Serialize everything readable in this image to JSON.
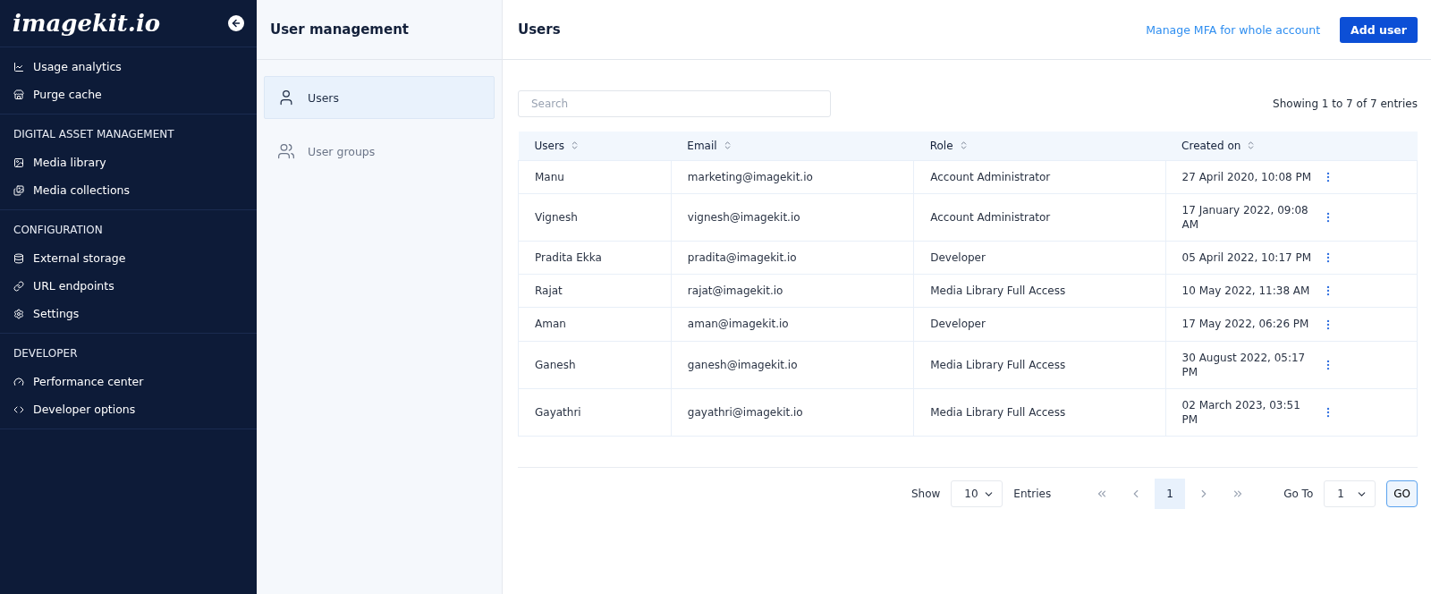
{
  "sidebar": {
    "logo": "imagekit.io",
    "sections": [
      {
        "items": [
          {
            "label": "Usage analytics"
          },
          {
            "label": "Purge cache"
          }
        ]
      },
      {
        "heading": "DIGITAL ASSET MANAGEMENT",
        "items": [
          {
            "label": "Media library"
          },
          {
            "label": "Media collections"
          }
        ]
      },
      {
        "heading": "CONFIGURATION",
        "items": [
          {
            "label": "External storage"
          },
          {
            "label": "URL endpoints"
          },
          {
            "label": "Settings"
          }
        ]
      },
      {
        "heading": "DEVELOPER",
        "items": [
          {
            "label": "Performance center"
          },
          {
            "label": "Developer options"
          }
        ]
      }
    ]
  },
  "subnav": {
    "title": "User management",
    "items": [
      {
        "label": "Users",
        "selected": true
      },
      {
        "label": "User groups",
        "selected": false
      }
    ]
  },
  "header": {
    "title": "Users",
    "link": "Manage MFA for whole account",
    "button": "Add user"
  },
  "search": {
    "placeholder": "Search"
  },
  "summary": "Showing 1 to 7 of 7 entries",
  "table": {
    "columns": [
      "Users",
      "Email",
      "Role",
      "Created on"
    ],
    "rows": [
      [
        "Manu",
        "marketing@imagekit.io",
        "Account Administrator",
        "27 April 2020, 10:08 PM"
      ],
      [
        "Vignesh",
        "vignesh@imagekit.io",
        "Account Administrator",
        "17 January 2022, 09:08 AM"
      ],
      [
        "Pradita Ekka",
        "pradita@imagekit.io",
        "Developer",
        "05 April 2022, 10:17 PM"
      ],
      [
        "Rajat",
        "rajat@imagekit.io",
        "Media Library Full Access",
        "10 May 2022, 11:38 AM"
      ],
      [
        "Aman",
        "aman@imagekit.io",
        "Developer",
        "17 May 2022, 06:26 PM"
      ],
      [
        "Ganesh",
        "ganesh@imagekit.io",
        "Media Library Full Access",
        "30 August 2022, 05:17 PM"
      ],
      [
        "Gayathri",
        "gayathri@imagekit.io",
        "Media Library Full Access",
        "02 March 2023, 03:51 PM"
      ]
    ]
  },
  "pagination": {
    "show_label": "Show",
    "page_size": "10",
    "entries_label": "Entries",
    "pages": [
      {
        "label": "1",
        "selected": true
      }
    ],
    "goto_label": "Go To",
    "goto_value": "1",
    "go_button": "GO"
  }
}
